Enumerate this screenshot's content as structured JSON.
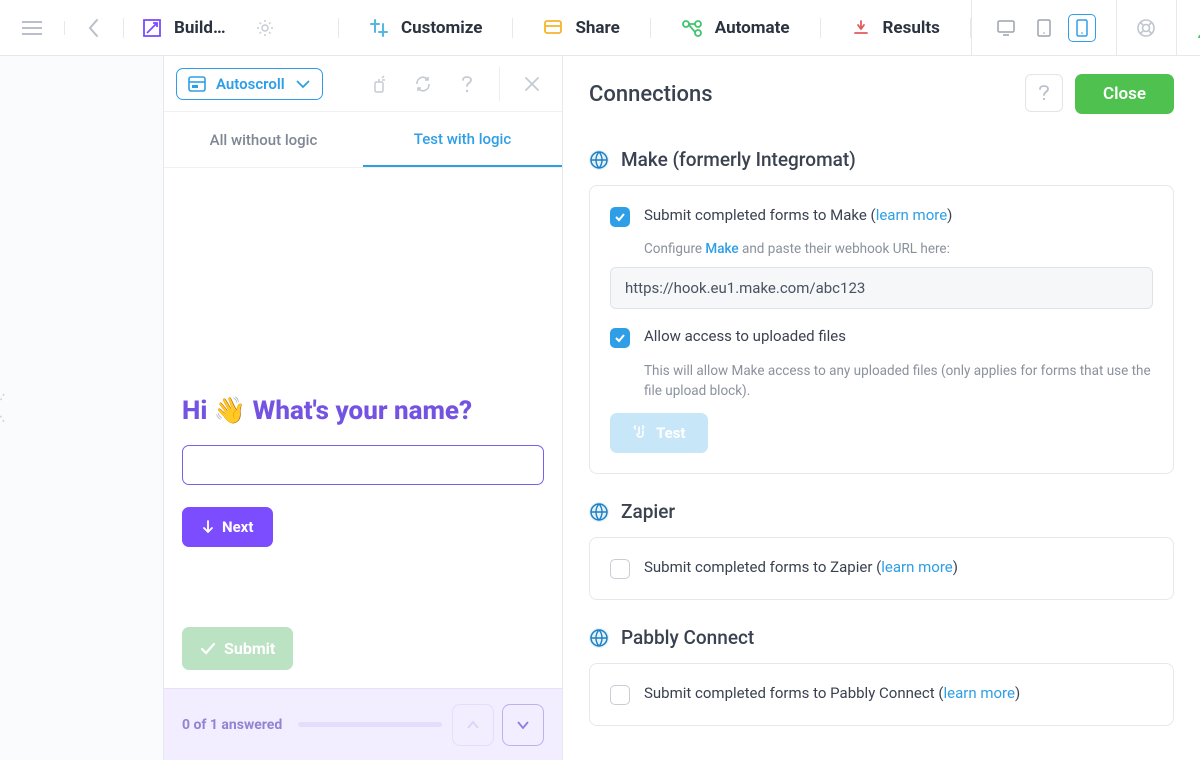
{
  "topbar": {
    "build_label": "Build…",
    "customize_label": "Customize",
    "share_label": "Share",
    "automate_label": "Automate",
    "results_label": "Results"
  },
  "preview": {
    "autoscroll_label": "Autoscroll",
    "tab_all_label": "All without logic",
    "tab_test_label": "Test with logic",
    "question_text": "Hi 👋 What's your name?",
    "next_label": "Next",
    "submit_label": "Submit",
    "footer_text": "0 of 1 answered"
  },
  "panel": {
    "title": "Connections",
    "close_label": "Close",
    "make": {
      "title": "Make (formerly Integromat)",
      "submit_label_pre": "Submit completed forms to Make (",
      "learn_more": "learn more",
      "submit_label_post": ")",
      "config_pre": "Configure ",
      "config_link": "Make",
      "config_post": " and paste their webhook URL here:",
      "webhook_value": "https://hook.eu1.make.com/abc123",
      "allow_label": "Allow access to uploaded files",
      "allow_desc": "This will allow Make access to any uploaded files (only applies for forms that use the file upload block).",
      "test_label": "Test"
    },
    "zapier": {
      "title": "Zapier",
      "submit_label_pre": "Submit completed forms to Zapier (",
      "learn_more": "learn more",
      "submit_label_post": ")"
    },
    "pabbly": {
      "title": "Pabbly Connect",
      "submit_label_pre": "Submit completed forms to Pabbly Connect (",
      "learn_more": "learn more",
      "submit_label_post": ")"
    }
  }
}
